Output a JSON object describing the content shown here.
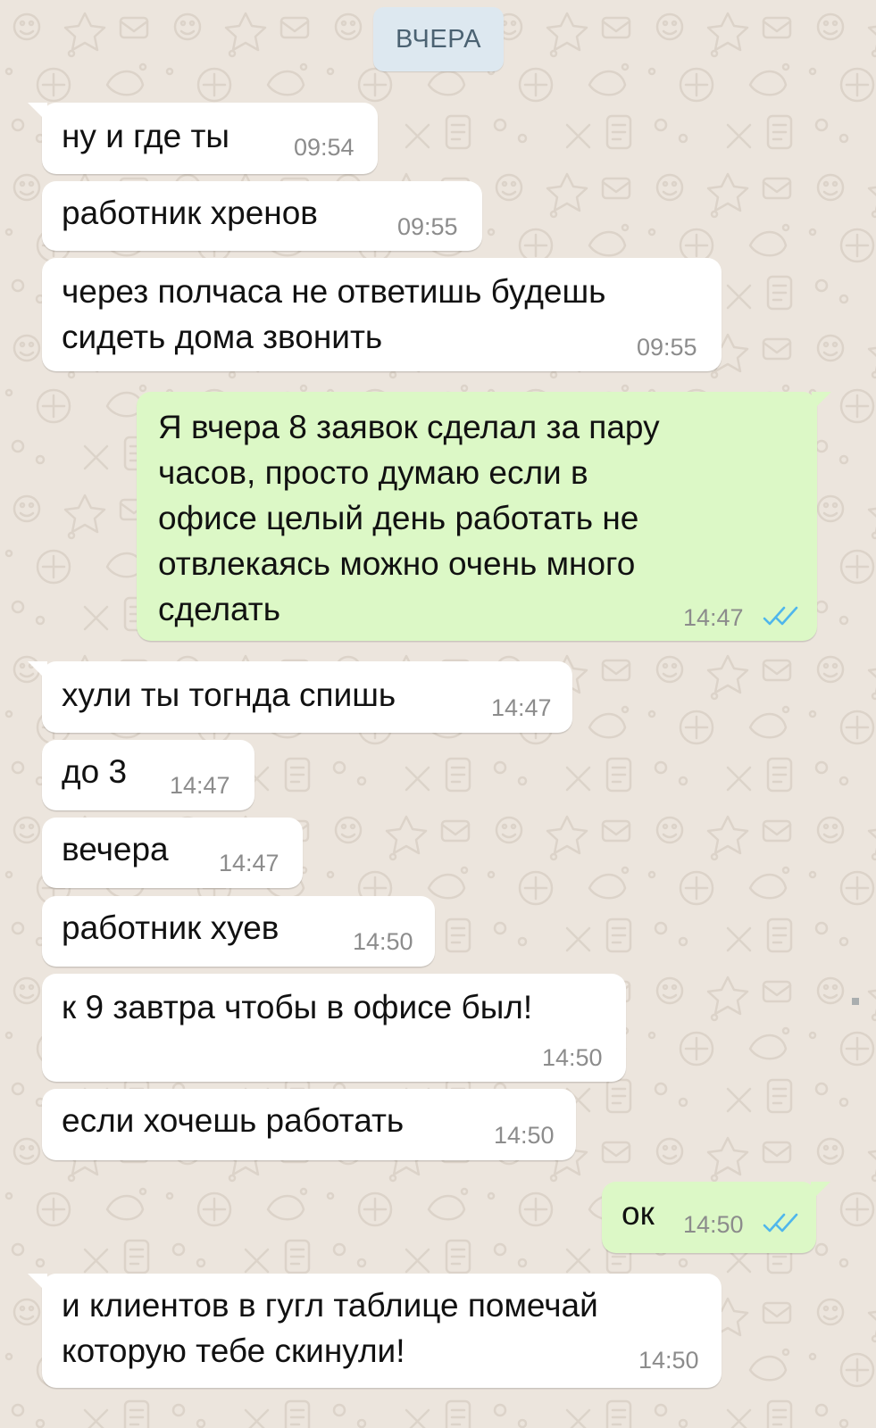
{
  "date_chip": "ВЧЕРА",
  "messages": [
    {
      "dir": "in",
      "text": [
        "ну и где ты"
      ],
      "time": "09:54"
    },
    {
      "dir": "in",
      "text": [
        "работник хренов"
      ],
      "time": "09:55"
    },
    {
      "dir": "in",
      "text": [
        "через полчаса не ответишь будешь",
        "сидеть дома звонить"
      ],
      "time": "09:55"
    },
    {
      "dir": "out",
      "text": [
        "Я вчера 8 заявок сделал за пару",
        "часов, просто думаю если в",
        "офисе целый день работать не",
        "отвлекаясь можно очень много",
        "сделать"
      ],
      "time": "14:47",
      "status": "read"
    },
    {
      "dir": "in",
      "text": [
        "хули ты тогнда спишь"
      ],
      "time": "14:47"
    },
    {
      "dir": "in",
      "text": [
        "до 3"
      ],
      "time": "14:47"
    },
    {
      "dir": "in",
      "text": [
        "вечера"
      ],
      "time": "14:47"
    },
    {
      "dir": "in",
      "text": [
        "работник хуев"
      ],
      "time": "14:50"
    },
    {
      "dir": "in",
      "text": [
        "к 9 завтра чтобы в офисе был!"
      ],
      "time": "14:50"
    },
    {
      "dir": "in",
      "text": [
        "если хочешь работать"
      ],
      "time": "14:50"
    },
    {
      "dir": "out",
      "text": [
        "ок"
      ],
      "time": "14:50",
      "status": "read"
    },
    {
      "dir": "in",
      "text": [
        "и клиентов в гугл таблице помечай",
        "которую тебе скинули!"
      ],
      "time": "14:50"
    }
  ],
  "colors": {
    "wallpaper": "#ece5dd",
    "incoming_bubble": "#ffffff",
    "outgoing_bubble": "#dcf8c6",
    "date_chip": "#dde8f0",
    "read_ticks": "#4fb6ec",
    "timestamp": "#8c8c8c"
  },
  "icons": {
    "read_status": "double-check-icon"
  }
}
